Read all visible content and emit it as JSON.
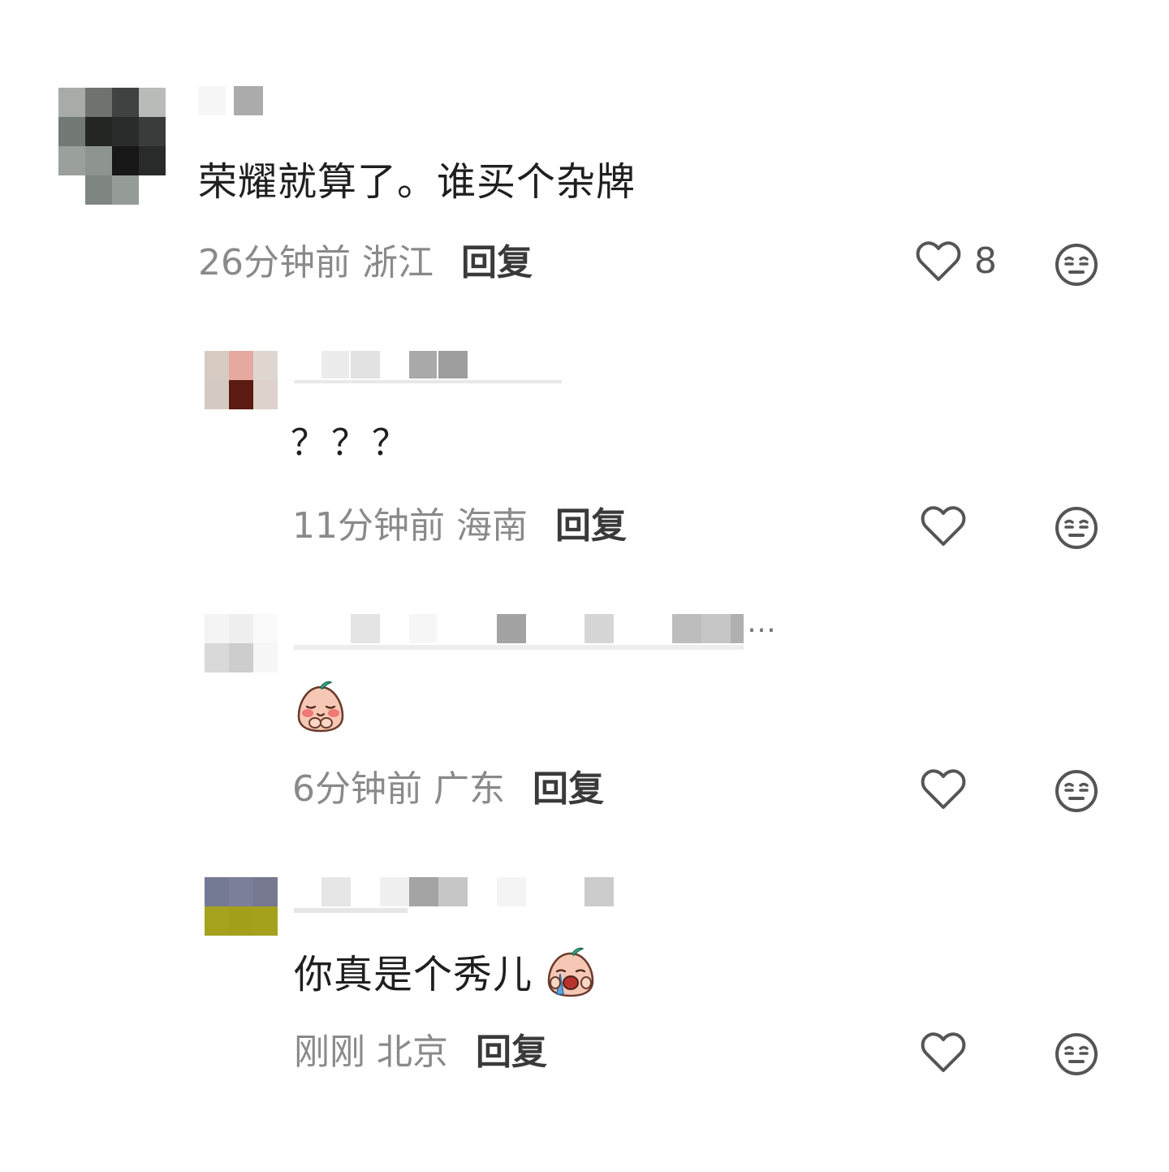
{
  "comments": [
    {
      "text": "荣耀就算了。谁买个杂牌",
      "time": "26分钟前",
      "location": "浙江",
      "reply_label": "回复",
      "likes": "8"
    },
    {
      "text": "？？？",
      "time": "11分钟前",
      "location": "海南",
      "reply_label": "回复",
      "likes": ""
    },
    {
      "text": "",
      "sticker": "shy-peach-sticker",
      "time": "6分钟前",
      "location": "广东",
      "reply_label": "回复",
      "likes": ""
    },
    {
      "text": "你真是个秀儿",
      "sticker": "crying-peach-sticker",
      "time": "刚刚",
      "location": "北京",
      "reply_label": "回复",
      "likes": ""
    }
  ],
  "username_truncation": "…",
  "icons": {
    "like": "heart-outline-icon",
    "dislike": "meh-face-icon"
  },
  "colors": {
    "meta_text": "#8a8a8a",
    "reply_text": "#3a3a3a",
    "icon_stroke": "#555555"
  }
}
